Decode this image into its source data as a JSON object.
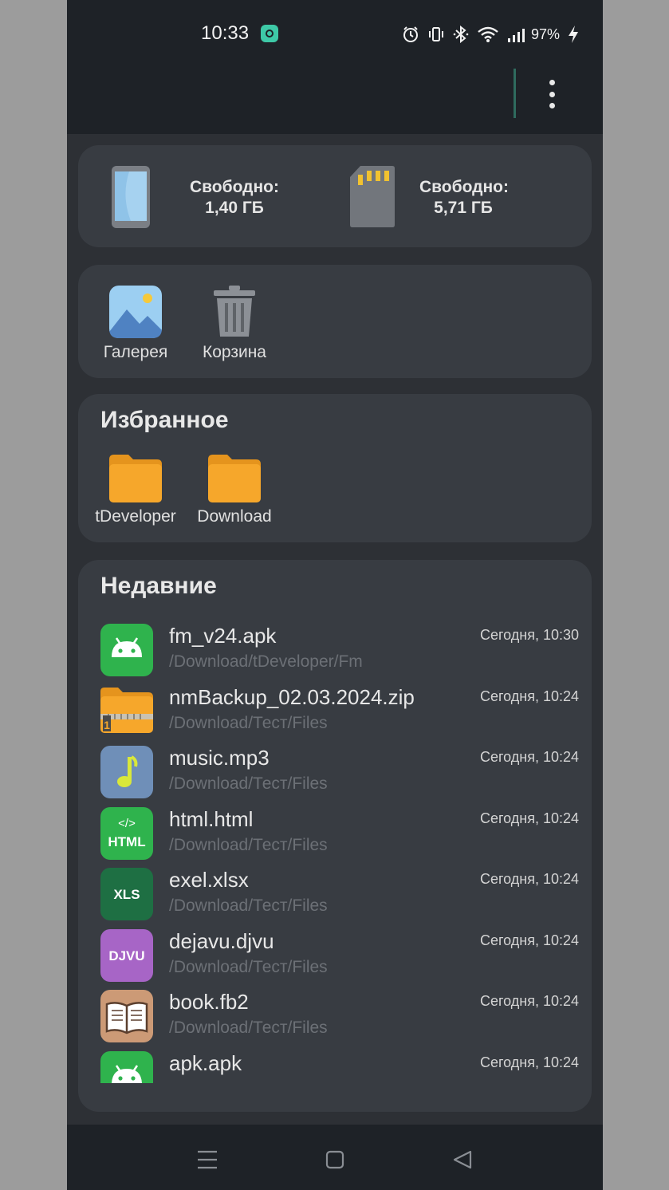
{
  "status_bar": {
    "time": "10:33",
    "battery": "97%",
    "icons": [
      "alarm-icon",
      "vibrate-icon",
      "bluetooth-icon",
      "wifi-icon",
      "signal-icon",
      "charging-icon"
    ]
  },
  "storage": {
    "internal": {
      "label": "Свободно:",
      "value": "1,40 ГБ",
      "icon": "phone-icon"
    },
    "sd_card": {
      "label": "Свободно:",
      "value": "5,71 ГБ",
      "icon": "sd-card-icon"
    }
  },
  "shortcuts": [
    {
      "label": "Галерея",
      "icon": "gallery-icon"
    },
    {
      "label": "Корзина",
      "icon": "trash-icon"
    }
  ],
  "favorites": {
    "title": "Избранное",
    "items": [
      {
        "label": "tDeveloper",
        "icon": "folder-icon"
      },
      {
        "label": "Download",
        "icon": "folder-icon"
      }
    ]
  },
  "recent": {
    "title": "Недавние",
    "files": [
      {
        "name": "fm_v24.apk",
        "path": "/Download/tDeveloper/Fm",
        "time": "Сегодня, 10:30",
        "icon": "android-apk-icon"
      },
      {
        "name": "nmBackup_02.03.2024.zip",
        "path": "/Download/Тест/Files",
        "time": "Сегодня, 10:24",
        "icon": "zip-archive-icon"
      },
      {
        "name": "music.mp3",
        "path": "/Download/Тест/Files",
        "time": "Сегодня, 10:24",
        "icon": "music-note-icon"
      },
      {
        "name": "html.html",
        "path": "/Download/Тест/Files",
        "time": "Сегодня, 10:24",
        "icon": "html-file-icon",
        "badge": "HTML",
        "badge_top": "</>"
      },
      {
        "name": "exel.xlsx",
        "path": "/Download/Тест/Files",
        "time": "Сегодня, 10:24",
        "icon": "xls-file-icon",
        "badge": "XLS"
      },
      {
        "name": "dejavu.djvu",
        "path": "/Download/Тест/Files",
        "time": "Сегодня, 10:24",
        "icon": "djvu-file-icon",
        "badge": "DJVU"
      },
      {
        "name": "book.fb2",
        "path": "/Download/Тест/Files",
        "time": "Сегодня, 10:24",
        "icon": "book-icon"
      },
      {
        "name": "apk.apk",
        "path": "",
        "time": "Сегодня, 10:24",
        "icon": "android-apk-icon"
      }
    ]
  },
  "colors": {
    "background": "#2d3035",
    "card": "#383c42",
    "bar": "#1e2227",
    "accent": "#3ec9a7",
    "folder": "#f6a72b",
    "apk_green": "#2fb34d",
    "html_green": "#2fb34d",
    "xls_green": "#1e6f43",
    "djvu_purple": "#a765c6",
    "music_blue": "#6f8fb8",
    "book_tan": "#cc9a76"
  }
}
